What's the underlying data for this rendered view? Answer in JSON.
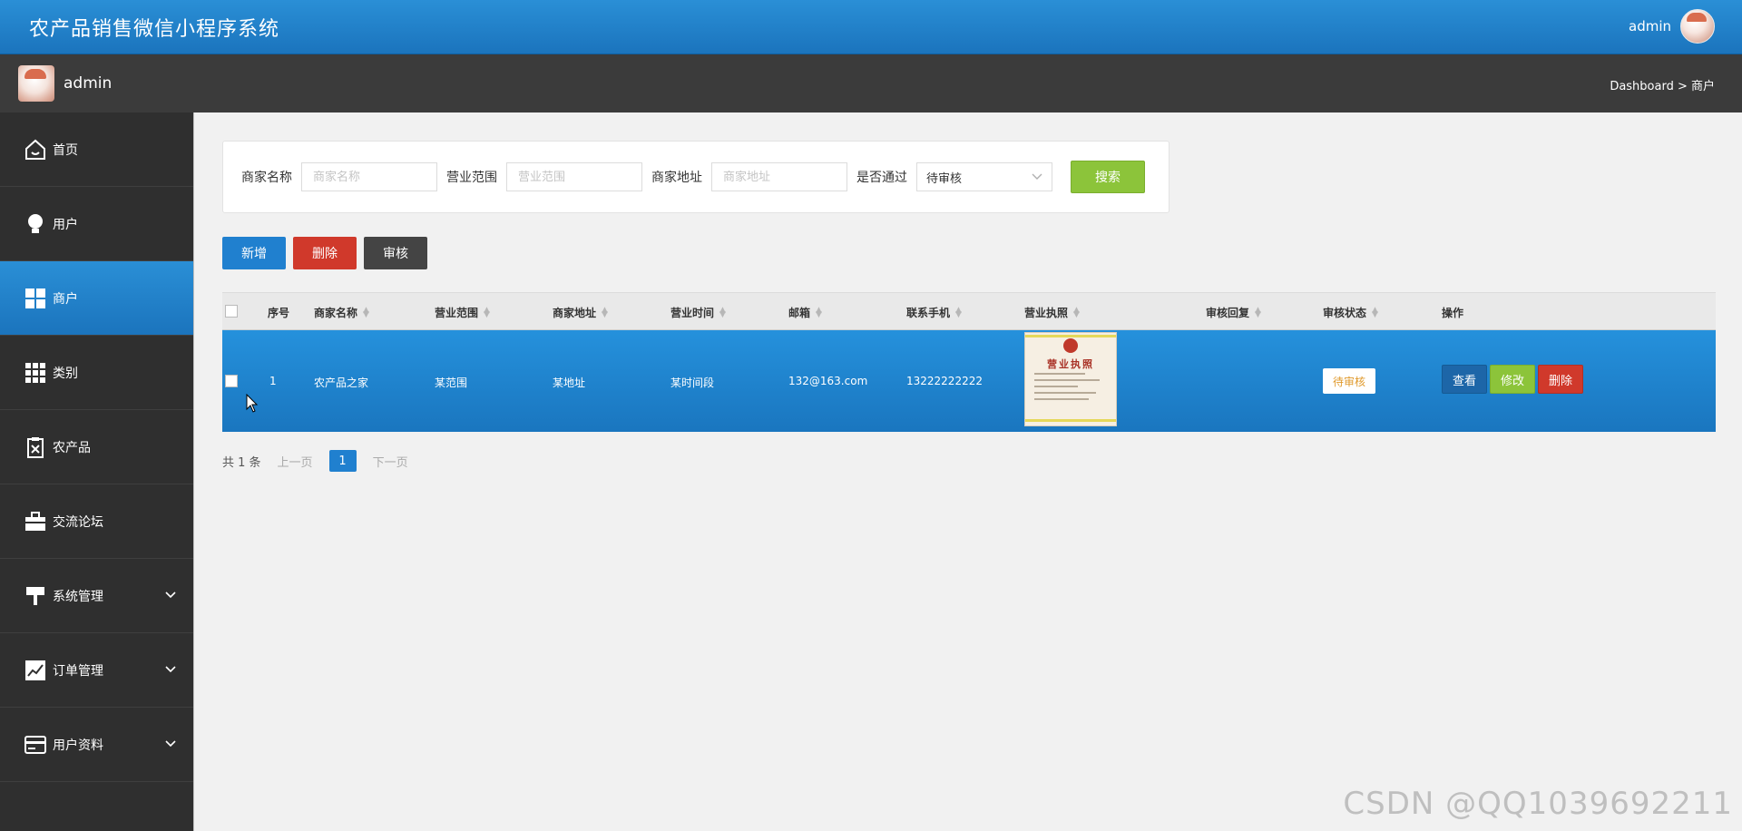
{
  "header": {
    "app_title": "农产品销售微信小程序系统",
    "user": "admin"
  },
  "subbar": {
    "user": "admin",
    "breadcrumb": "Dashboard > 商户"
  },
  "sidebar": {
    "items": [
      {
        "label": "首页",
        "icon": "home-icon"
      },
      {
        "label": "用户",
        "icon": "bulb-icon"
      },
      {
        "label": "商户",
        "icon": "grid-icon",
        "active": true
      },
      {
        "label": "类别",
        "icon": "apps-icon"
      },
      {
        "label": "农产品",
        "icon": "clipboard-icon"
      },
      {
        "label": "交流论坛",
        "icon": "briefcase-icon"
      },
      {
        "label": "系统管理",
        "icon": "paint-roller-icon",
        "expandable": true
      },
      {
        "label": "订单管理",
        "icon": "chart-icon",
        "expandable": true
      },
      {
        "label": "用户资料",
        "icon": "card-icon",
        "expandable": true
      }
    ]
  },
  "search": {
    "name_label": "商家名称",
    "name_placeholder": "商家名称",
    "scope_label": "营业范围",
    "scope_placeholder": "营业范围",
    "address_label": "商家地址",
    "address_placeholder": "商家地址",
    "approved_label": "是否通过",
    "approved_value": "待审核",
    "search_button": "搜索"
  },
  "actions": {
    "add": "新增",
    "delete": "删除",
    "review": "审核"
  },
  "table": {
    "columns": [
      "序号",
      "商家名称",
      "营业范围",
      "商家地址",
      "营业时间",
      "邮箱",
      "联系手机",
      "营业执照",
      "审核回复",
      "审核状态",
      "操作"
    ],
    "rows": [
      {
        "index": "1",
        "name": "农产品之家",
        "scope": "某范围",
        "address": "某地址",
        "hours": "某时间段",
        "email": "132@163.com",
        "phone": "13222222222",
        "license_text": "营业执照",
        "reply": "",
        "status": "待审核",
        "ops": {
          "view": "查看",
          "edit": "修改",
          "delete": "删除"
        }
      }
    ]
  },
  "pager": {
    "total": "共 1 条",
    "prev": "上一页",
    "page": "1",
    "next": "下一页"
  },
  "watermark": "CSDN @QQ1039692211",
  "colors": {
    "primary": "#1b74bd",
    "success": "#8cc43a",
    "danger": "#d0392b",
    "sidebar": "#2f2f2f"
  }
}
